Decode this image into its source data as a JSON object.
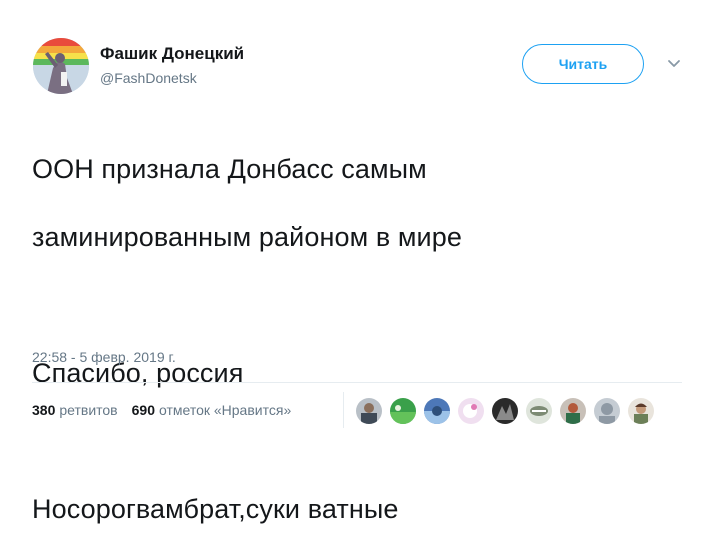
{
  "author": {
    "name": "Фашик Донецкий",
    "handle": "@FashDonetsk"
  },
  "follow_button": {
    "label": "Читать"
  },
  "menu": {
    "icon": "chevron-down-icon"
  },
  "tweet": {
    "line1": "ООН признала Донбасс самым",
    "line2": "заминированным районом в мире",
    "line3": "Спасибо, россия",
    "line4": "Носорогвамбрат,суки ватные"
  },
  "timestamp": "22:58 - 5 февр. 2019 г.",
  "stats": {
    "retweets_count": "380",
    "retweets_label": "ретвитов",
    "likes_count": "690",
    "likes_label": "отметок «Нравится»"
  },
  "colors": {
    "accent": "#1da1f2",
    "muted": "#657786",
    "text": "#14171a"
  }
}
